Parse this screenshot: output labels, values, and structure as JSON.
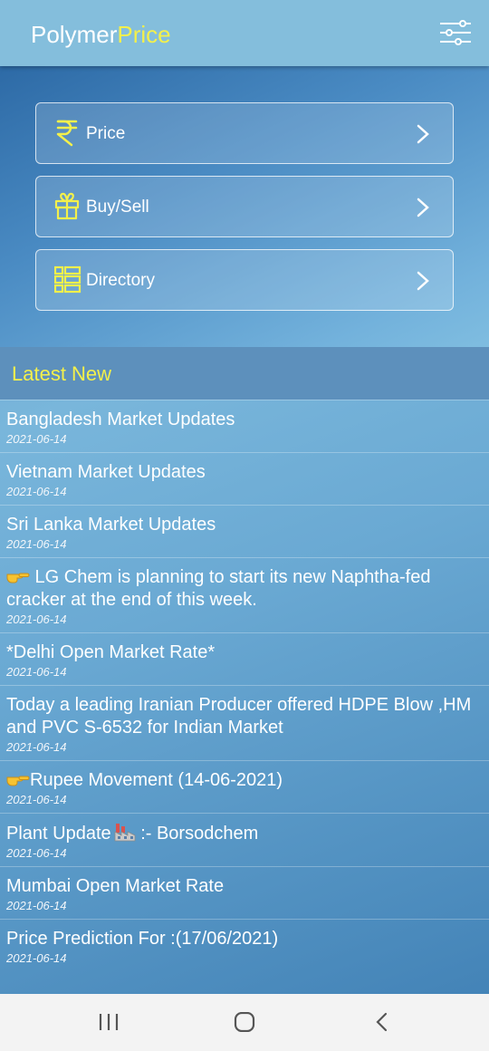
{
  "app": {
    "title_part1": "Polymer",
    "title_part2": "Price",
    "settings_icon": "sliders-icon",
    "accent_color": "#f3f04b"
  },
  "menu": [
    {
      "label": "Price",
      "icon": "rupee-icon"
    },
    {
      "label": "Buy/Sell",
      "icon": "gift-icon"
    },
    {
      "label": "Directory",
      "icon": "list-icon"
    }
  ],
  "latest": {
    "title": "Latest New",
    "items": [
      {
        "headline": "Bangladesh Market Updates",
        "date": "2021-06-14"
      },
      {
        "headline": "Vietnam Market Updates",
        "date": "2021-06-14"
      },
      {
        "headline": "Sri Lanka Market Updates",
        "date": "2021-06-14"
      },
      {
        "headline": " LG Chem is planning to start its new Naphtha-fed cracker at the end of this week.",
        "date": "2021-06-14",
        "emoji": "pointing-hand-icon"
      },
      {
        "headline": "*Delhi Open Market Rate*",
        "date": "2021-06-14"
      },
      {
        "headline": "Today a leading Iranian Producer offered HDPE Blow ,HM  and PVC S-6532 for Indian Market",
        "date": "2021-06-14"
      },
      {
        "headline": "Rupee Movement (14-06-2021)",
        "date": "2021-06-14",
        "emoji": "pointing-hand-icon"
      },
      {
        "headline": "Plant Update",
        "headline_suffix": " :-   Borsodchem",
        "date": "2021-06-14",
        "emoji_after": "factory-icon"
      },
      {
        "headline": "Mumbai Open Market Rate",
        "date": "2021-06-14"
      },
      {
        "headline": "Price Prediction For :(17/06/2021)",
        "date": "2021-06-14"
      }
    ]
  },
  "navbar": {
    "recent": "recents-icon",
    "home": "home-icon",
    "back": "back-icon"
  }
}
